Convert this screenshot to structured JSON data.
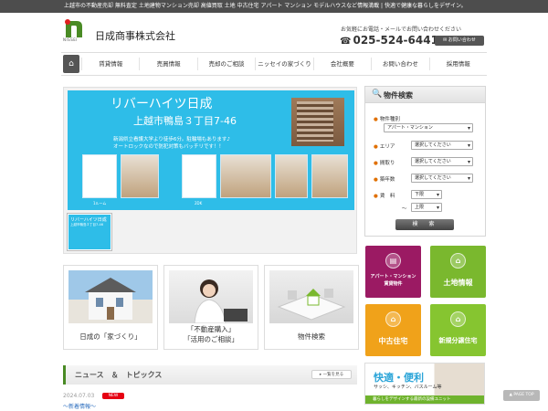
{
  "topbar": {
    "text": "上越市の不動産売却 無料査定 土地建物マンション売却 高値買取 土地 中古住宅 アパート マンション モデルハウスなど情報満載 | 快適で健康な暮らしをデザイン。"
  },
  "header": {
    "logo_word": "NISSEI",
    "company_name": "日成商事株式会社",
    "contact_hint": "お気軽にお電話・メールでお問い合わせください",
    "phone": "025-524-6441",
    "inquiry_button": "お問い合わせ"
  },
  "nav": {
    "items": [
      "賃貸情報",
      "売買情報",
      "売却のご相談",
      "ニッセイの家づくり",
      "会社概要",
      "お問い合わせ",
      "採用情報"
    ]
  },
  "banner": {
    "title": "リバーハイツ日成",
    "address": "上越市鴨島３丁目7-46",
    "note_line1": "新潟県立看護大学より徒歩6分。駐輪場もあります♪",
    "note_line2": "オートロックなので防犯対策もバッチリです！！",
    "caption_left": "1ルーム",
    "caption_right": "2DK",
    "thumb_title": "リバーハイツ日成",
    "thumb_addr": "上越市鴨島３丁目7-46"
  },
  "cards": [
    {
      "label": "日成の「家づくり」"
    },
    {
      "label_line1": "「不動産購入」",
      "label_line2": "「活用のご相談」"
    },
    {
      "label": "物件検索"
    }
  ],
  "news": {
    "title": "ニュース　＆　トピックス",
    "more_button": "一覧を見る",
    "date": "2024.07.03",
    "badge": "NEW",
    "link": "～新着情報～"
  },
  "search": {
    "title": "物件検索",
    "type_label": "物件種別",
    "type_value": "アパート・マンション",
    "area_label": "エリア",
    "madori_label": "間取り",
    "age_label": "築年数",
    "rent_label": "賃　料",
    "placeholder": "選択してください",
    "min_value": "下限",
    "max_value": "上限",
    "wave": "～",
    "button": "検　索"
  },
  "tiles": [
    {
      "line1": "アパート・マンション",
      "line2": "賃貸物件",
      "color": "#9b1a63",
      "icon": "building-icon"
    },
    {
      "line1": "土地情報",
      "color": "#7ab82e",
      "icon": "land-icon"
    },
    {
      "line1": "中古住宅",
      "color": "#f0a21a",
      "icon": "house-icon"
    },
    {
      "line1": "新規分譲住宅",
      "color": "#86c530",
      "icon": "new-house-icon"
    }
  ],
  "promo": {
    "title": "快適・便利",
    "subtitle": "サッシ、キッチン、バスルーム等",
    "footer": "暮らしをデザインする最新の設備ユニット"
  },
  "pagetop": "▲ PAGE TOP",
  "colors": {
    "banner": "#2ebde8",
    "accent_green": "#4a8b25",
    "new_badge": "#e60012"
  }
}
